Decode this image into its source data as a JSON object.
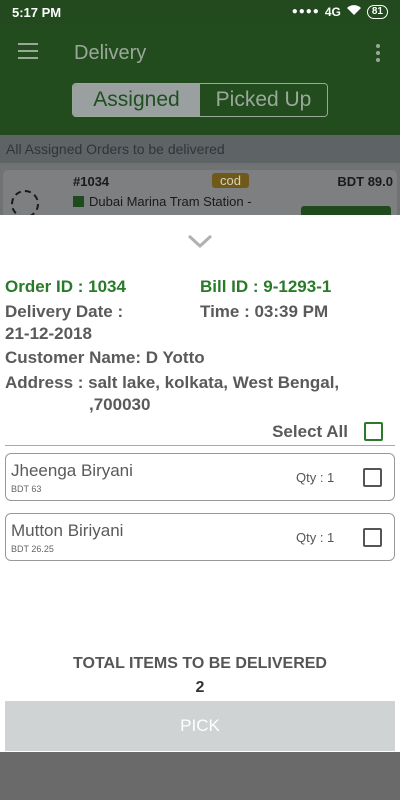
{
  "status_bar": {
    "time": "5:17 PM",
    "network": "4G",
    "battery": "81"
  },
  "app_bar": {
    "title": "Delivery"
  },
  "tabs": [
    {
      "label": "Assigned"
    },
    {
      "label": "Picked Up"
    }
  ],
  "subheader": "All Assigned Orders to be delivered",
  "background_order": {
    "order_no": "#1034",
    "payment_badge": "cod",
    "amount": "BDT 89.0",
    "address": "Dubai Marina Tram Station -"
  },
  "sheet": {
    "order_id": "Order ID : 1034",
    "bill_id": "Bill ID : 9-1293-1",
    "delivery_date_label": "Delivery Date :",
    "delivery_date": "21-12-2018",
    "time": "Time : 03:39 PM",
    "customer": "Customer Name: D Yotto",
    "address_line1": "Address : salt lake, kolkata, West Bengal,",
    "address_line2": ",700030",
    "select_all": "Select All",
    "items": [
      {
        "name": "Jheenga Biryani",
        "price": "BDT 63",
        "qty": "Qty : 1"
      },
      {
        "name": "Mutton Biriyani",
        "price": "BDT 26.25",
        "qty": "Qty : 1"
      }
    ],
    "total_label": "TOTAL ITEMS TO BE DELIVERED",
    "total_value": "2",
    "pick_button": "PICK"
  },
  "colors": {
    "accent_green": "#2a7a2a",
    "app_bar": "#224c1e",
    "pick_button": "#cfd3d4"
  }
}
